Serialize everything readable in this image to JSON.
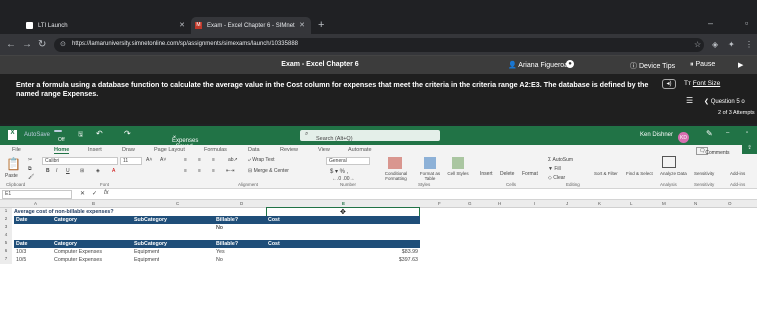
{
  "browser": {
    "tab1": "LTI Launch",
    "tab2": "Exam - Excel Chapter 6 - SIMnet",
    "url": "https://lamaruniversity.simnetonline.com/sp/assignments/simexams/launch/10335888"
  },
  "header": {
    "title": "Exam - Excel Chapter 6",
    "user": "Ariana Figueroa",
    "tips": "Device Tips",
    "pause": "Pause"
  },
  "instructions": {
    "text": "Enter a formula using a database function to calculate the average value in the Cost column for expenses that meet the criteria in the criteria range A2:E3. The database is defined by the named range Expenses.",
    "font_size_label": "Font Size",
    "question": "Question 5 o",
    "attempt": "2 of 3 Attempts"
  },
  "excel": {
    "autosave": "AutoSave",
    "autosave_state": "Off",
    "doc": "Expenses - Saved",
    "search": "Search (Alt+Q)",
    "user": "Ken Dishner",
    "initials": "KD",
    "tabs": [
      "File",
      "Home",
      "Insert",
      "Draw",
      "Page Layout",
      "Formulas",
      "Data",
      "Review",
      "View",
      "Automate"
    ],
    "comments": "Comments",
    "font": "Calibri",
    "font_size": "11",
    "wrap_text": "Wrap Text",
    "merge": "Merge & Center",
    "number_format": "General",
    "autosum": "AutoSum",
    "fill": "Fill",
    "clear": "Clear",
    "ribbon_buttons": [
      "Paste",
      "Conditional Formatting",
      "Format as Table",
      "Cell Styles",
      "Insert",
      "Delete",
      "Format",
      "Sort & Filter",
      "Find & Select",
      "Analyze Data",
      "Sensitivity",
      "Add-ins"
    ],
    "groups": [
      "Clipboard",
      "Font",
      "Alignment",
      "Number",
      "Styles",
      "Cells",
      "Editing",
      "Analysis",
      "Sensitivity",
      "Add-ins"
    ],
    "namebox": "E1",
    "fx": "fx",
    "columns": [
      "A",
      "B",
      "C",
      "D",
      "E",
      "F",
      "G",
      "H",
      "I",
      "J",
      "K",
      "L",
      "M",
      "N",
      "O"
    ],
    "row_numbers": [
      "1",
      "2",
      "3",
      "4",
      "5",
      "6",
      "7"
    ],
    "sheet": {
      "a1": "Average cost of non-billable expenses?",
      "criteria_headers": [
        "Date",
        "Category",
        "SubCategory",
        "Billable?",
        "Cost"
      ],
      "criteria_row": [
        "",
        "",
        "",
        "No",
        ""
      ],
      "db_headers": [
        "Date",
        "Category",
        "SubCategory",
        "Billable?",
        "Cost"
      ],
      "rows": [
        [
          "10/3",
          "Computer Expenses",
          "Equipment",
          "Yes",
          "$83.99"
        ],
        [
          "10/5",
          "Computer Expenses",
          "Equipment",
          "No",
          "$397.63"
        ]
      ]
    }
  }
}
